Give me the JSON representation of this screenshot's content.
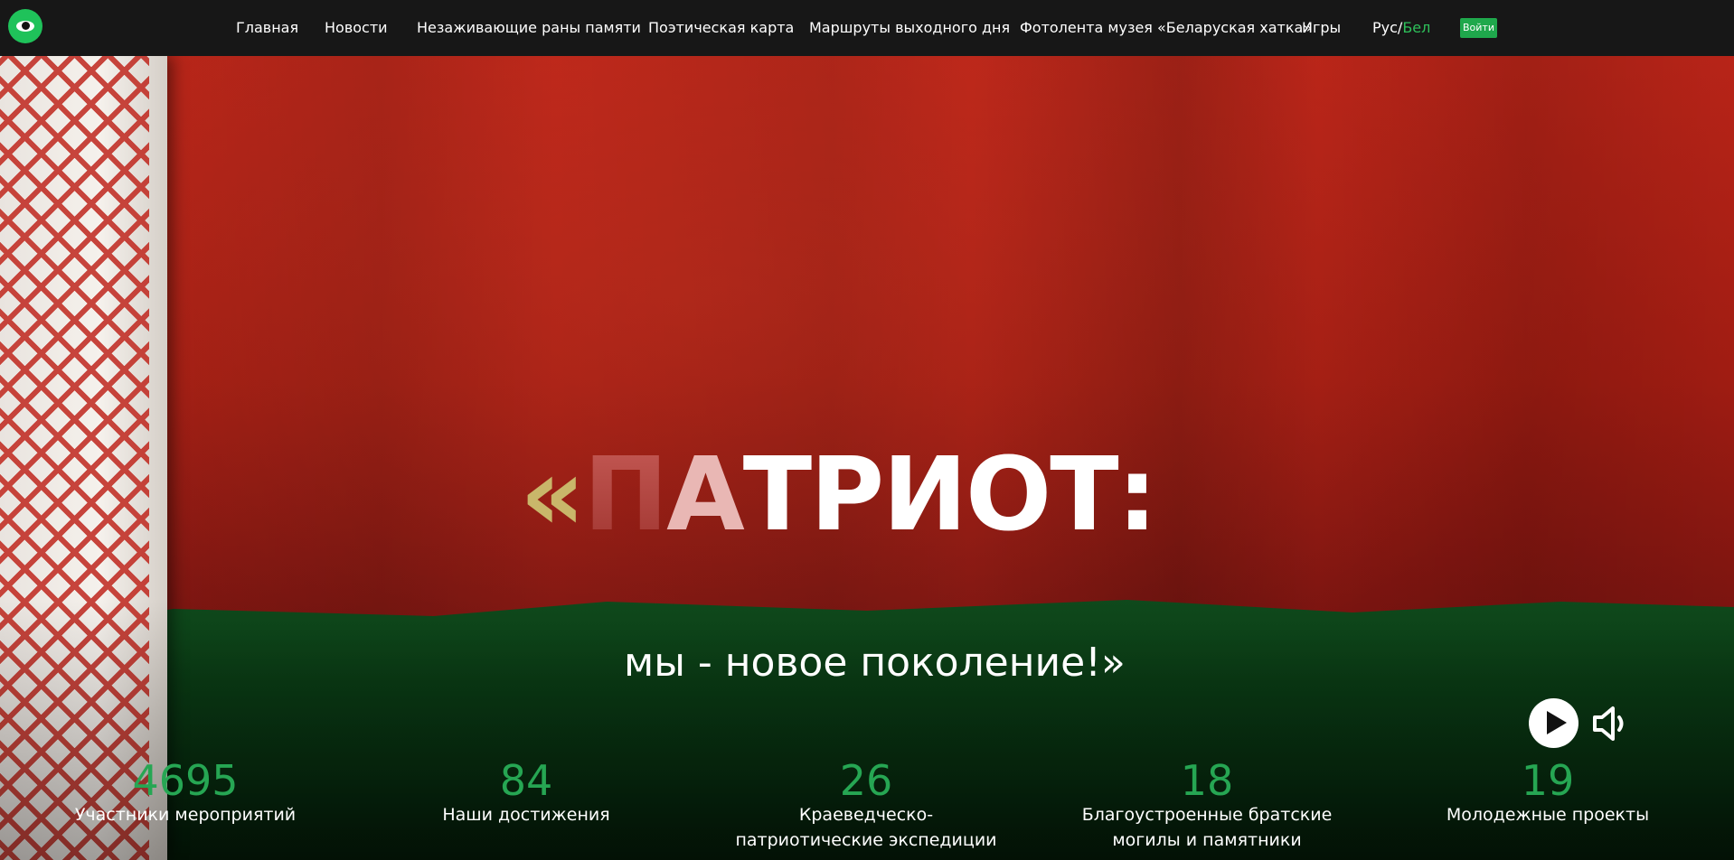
{
  "nav": {
    "items": [
      "Главная",
      "Новости",
      "Незаживающие раны памяти",
      "Поэтическая карта",
      "Маршруты выходного дня",
      "Фотолента музея «Беларуская хатка»",
      "Игры"
    ],
    "lang_ru": "Рус/",
    "lang_be": "Бел",
    "login": "Войти"
  },
  "hero": {
    "quote_open": "«",
    "title_part1": "П",
    "title_part2": "А",
    "title_part3": "ТРИОТ:",
    "subtitle": "мы - новое поколение!»"
  },
  "stats": [
    {
      "value": "4695",
      "label": "Участники мероприятий"
    },
    {
      "value": "84",
      "label": "Наши достижения"
    },
    {
      "value": "26",
      "label": "Краеведческо-патриотические экспедиции"
    },
    {
      "value": "18",
      "label": "Благоустроенные братские могилы и памятники"
    },
    {
      "value": "19",
      "label": "Молодежные проекты"
    }
  ],
  "colors": {
    "accent_green": "#1fc25a",
    "stat_number": "#26a653",
    "navbar_bg": "#171717"
  },
  "icons": {
    "logo": "eye-icon",
    "play": "play-icon",
    "sound": "speaker-icon"
  }
}
